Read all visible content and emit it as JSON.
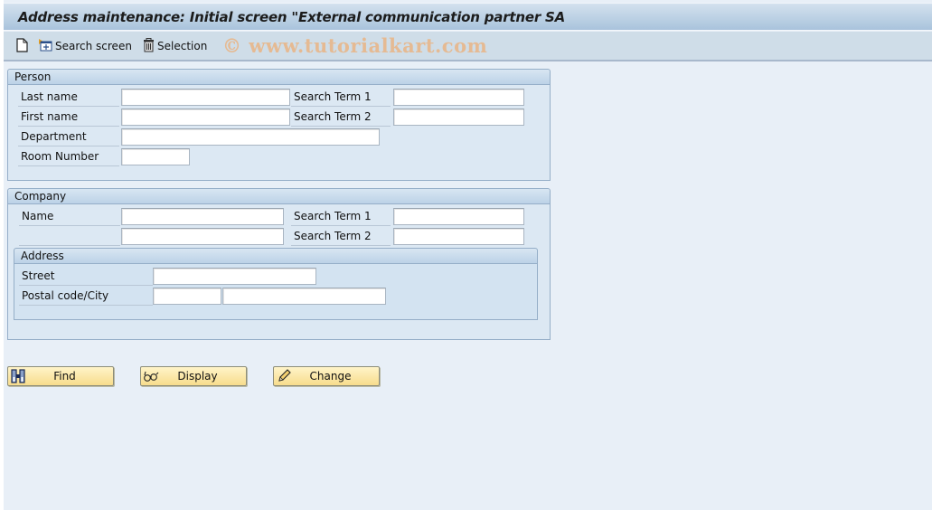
{
  "window": {
    "title": "Address maintenance: Initial screen \"External communication partner SA"
  },
  "toolbar": {
    "items": [
      {
        "icon": "new-document-icon",
        "label": ""
      },
      {
        "icon": "search-screen-icon",
        "label": "Search screen"
      },
      {
        "icon": "trash-icon",
        "label": "Selection"
      }
    ],
    "watermark": "© www.tutorialkart.com"
  },
  "person": {
    "title": "Person",
    "last_name": {
      "label": "Last name",
      "value": ""
    },
    "first_name": {
      "label": "First name",
      "value": ""
    },
    "department": {
      "label": "Department",
      "value": ""
    },
    "room_number": {
      "label": "Room Number",
      "value": ""
    },
    "search_term_1": {
      "label": "Search Term 1",
      "value": ""
    },
    "search_term_2": {
      "label": "Search Term 2",
      "value": ""
    }
  },
  "company": {
    "title": "Company",
    "name": {
      "label": "Name",
      "value": "",
      "value2": ""
    },
    "search_term_1": {
      "label": "Search Term 1",
      "value": ""
    },
    "search_term_2": {
      "label": "Search Term 2",
      "value": ""
    },
    "address": {
      "title": "Address",
      "street": {
        "label": "Street",
        "value": ""
      },
      "postal_city": {
        "label": "Postal code/City",
        "postal_value": "",
        "city_value": ""
      }
    }
  },
  "buttons": {
    "find": {
      "label": "Find",
      "icon": "binoculars-icon"
    },
    "display": {
      "label": "Display",
      "icon": "glasses-icon"
    },
    "change": {
      "label": "Change",
      "icon": "pencil-icon"
    }
  },
  "colors": {
    "button_bg": "#f7dc8c",
    "titlebar": "#bcd2e7",
    "background": "#e8eff7",
    "watermark": "#e9b585"
  }
}
